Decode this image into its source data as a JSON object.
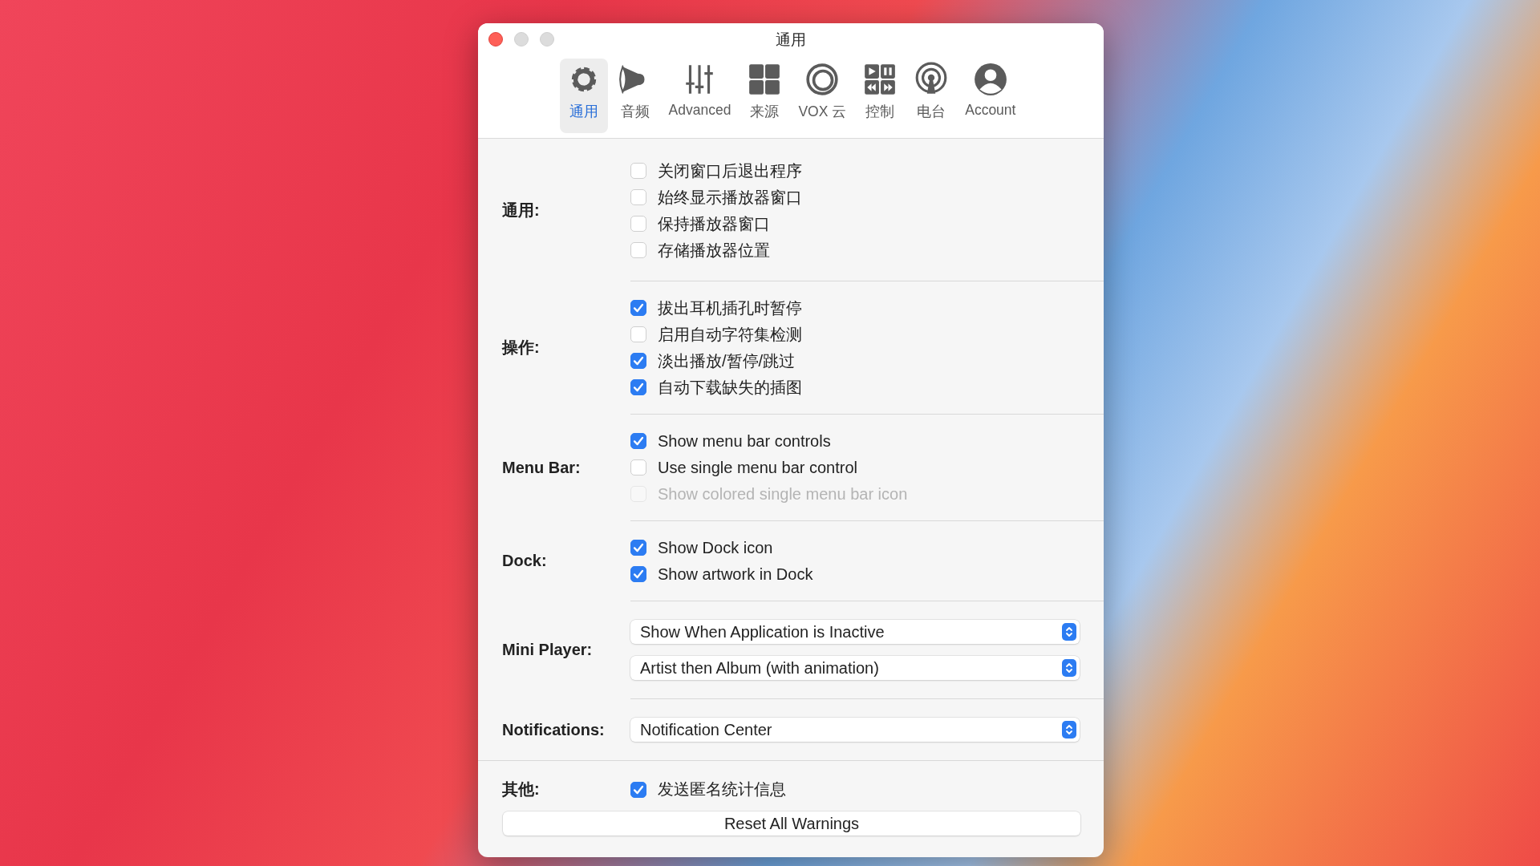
{
  "window": {
    "title": "通用"
  },
  "toolbar": [
    {
      "label": "通用",
      "selected": true
    },
    {
      "label": "音频",
      "selected": false
    },
    {
      "label": "Advanced",
      "selected": false
    },
    {
      "label": "来源",
      "selected": false
    },
    {
      "label": "VOX 云",
      "selected": false
    },
    {
      "label": "控制",
      "selected": false
    },
    {
      "label": "电台",
      "selected": false
    },
    {
      "label": "Account",
      "selected": false
    }
  ],
  "sections": [
    {
      "kind": "checks",
      "label": "通用:",
      "options": [
        {
          "label": "关闭窗口后退出程序",
          "checked": false,
          "disabled": false
        },
        {
          "label": "始终显示播放器窗口",
          "checked": false,
          "disabled": false
        },
        {
          "label": "保持播放器窗口",
          "checked": false,
          "disabled": false
        },
        {
          "label": "存储播放器位置",
          "checked": false,
          "disabled": false
        }
      ]
    },
    {
      "kind": "checks",
      "label": "操作:",
      "options": [
        {
          "label": "拔出耳机插孔时暂停",
          "checked": true,
          "disabled": false
        },
        {
          "label": "启用自动字符集检测",
          "checked": false,
          "disabled": false
        },
        {
          "label": "淡出播放/暂停/跳过",
          "checked": true,
          "disabled": false
        },
        {
          "label": "自动下载缺失的插图",
          "checked": true,
          "disabled": false
        }
      ]
    },
    {
      "kind": "checks",
      "label": "Menu Bar:",
      "options": [
        {
          "label": "Show menu bar controls",
          "checked": true,
          "disabled": false
        },
        {
          "label": "Use single menu bar control",
          "checked": false,
          "disabled": false
        },
        {
          "label": "Show colored single menu bar icon",
          "checked": false,
          "disabled": true
        }
      ]
    },
    {
      "kind": "checks",
      "label": "Dock:",
      "options": [
        {
          "label": "Show Dock icon",
          "checked": true,
          "disabled": false
        },
        {
          "label": "Show artwork in Dock",
          "checked": true,
          "disabled": false
        }
      ]
    },
    {
      "kind": "popups",
      "label": "Mini Player:",
      "popups": [
        {
          "value": "Show When Application is Inactive"
        },
        {
          "value": "Artist then Album (with animation)"
        }
      ]
    },
    {
      "kind": "popups",
      "label": "Notifications:",
      "popups": [
        {
          "value": "Notification Center"
        }
      ]
    },
    {
      "kind": "checks",
      "label": "其他:",
      "options": [
        {
          "label": "发送匿名统计信息",
          "checked": true,
          "disabled": false
        }
      ]
    }
  ],
  "footer_button": "Reset All Warnings"
}
